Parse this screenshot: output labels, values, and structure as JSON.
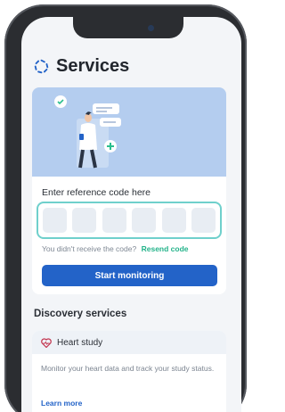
{
  "header": {
    "title": "Services",
    "logo_icon": "services-logo-icon"
  },
  "reference": {
    "prompt": "Enter reference code here",
    "code_digits": [
      "",
      "",
      "",
      "",
      "",
      ""
    ],
    "resend_question": "You didn't receive the code?",
    "resend_link": "Resend code",
    "start_button": "Start monitoring"
  },
  "discovery": {
    "title": "Discovery services",
    "items": [
      {
        "name": "Heart study",
        "icon": "heartbeat-icon",
        "description": "Monitor your heart data and track your study status.",
        "link": "Learn more"
      }
    ]
  },
  "colors": {
    "primary": "#2363c8",
    "accent_green": "#24b38a",
    "code_border": "#6fd0cc",
    "hero_bg": "#b4cdef"
  }
}
